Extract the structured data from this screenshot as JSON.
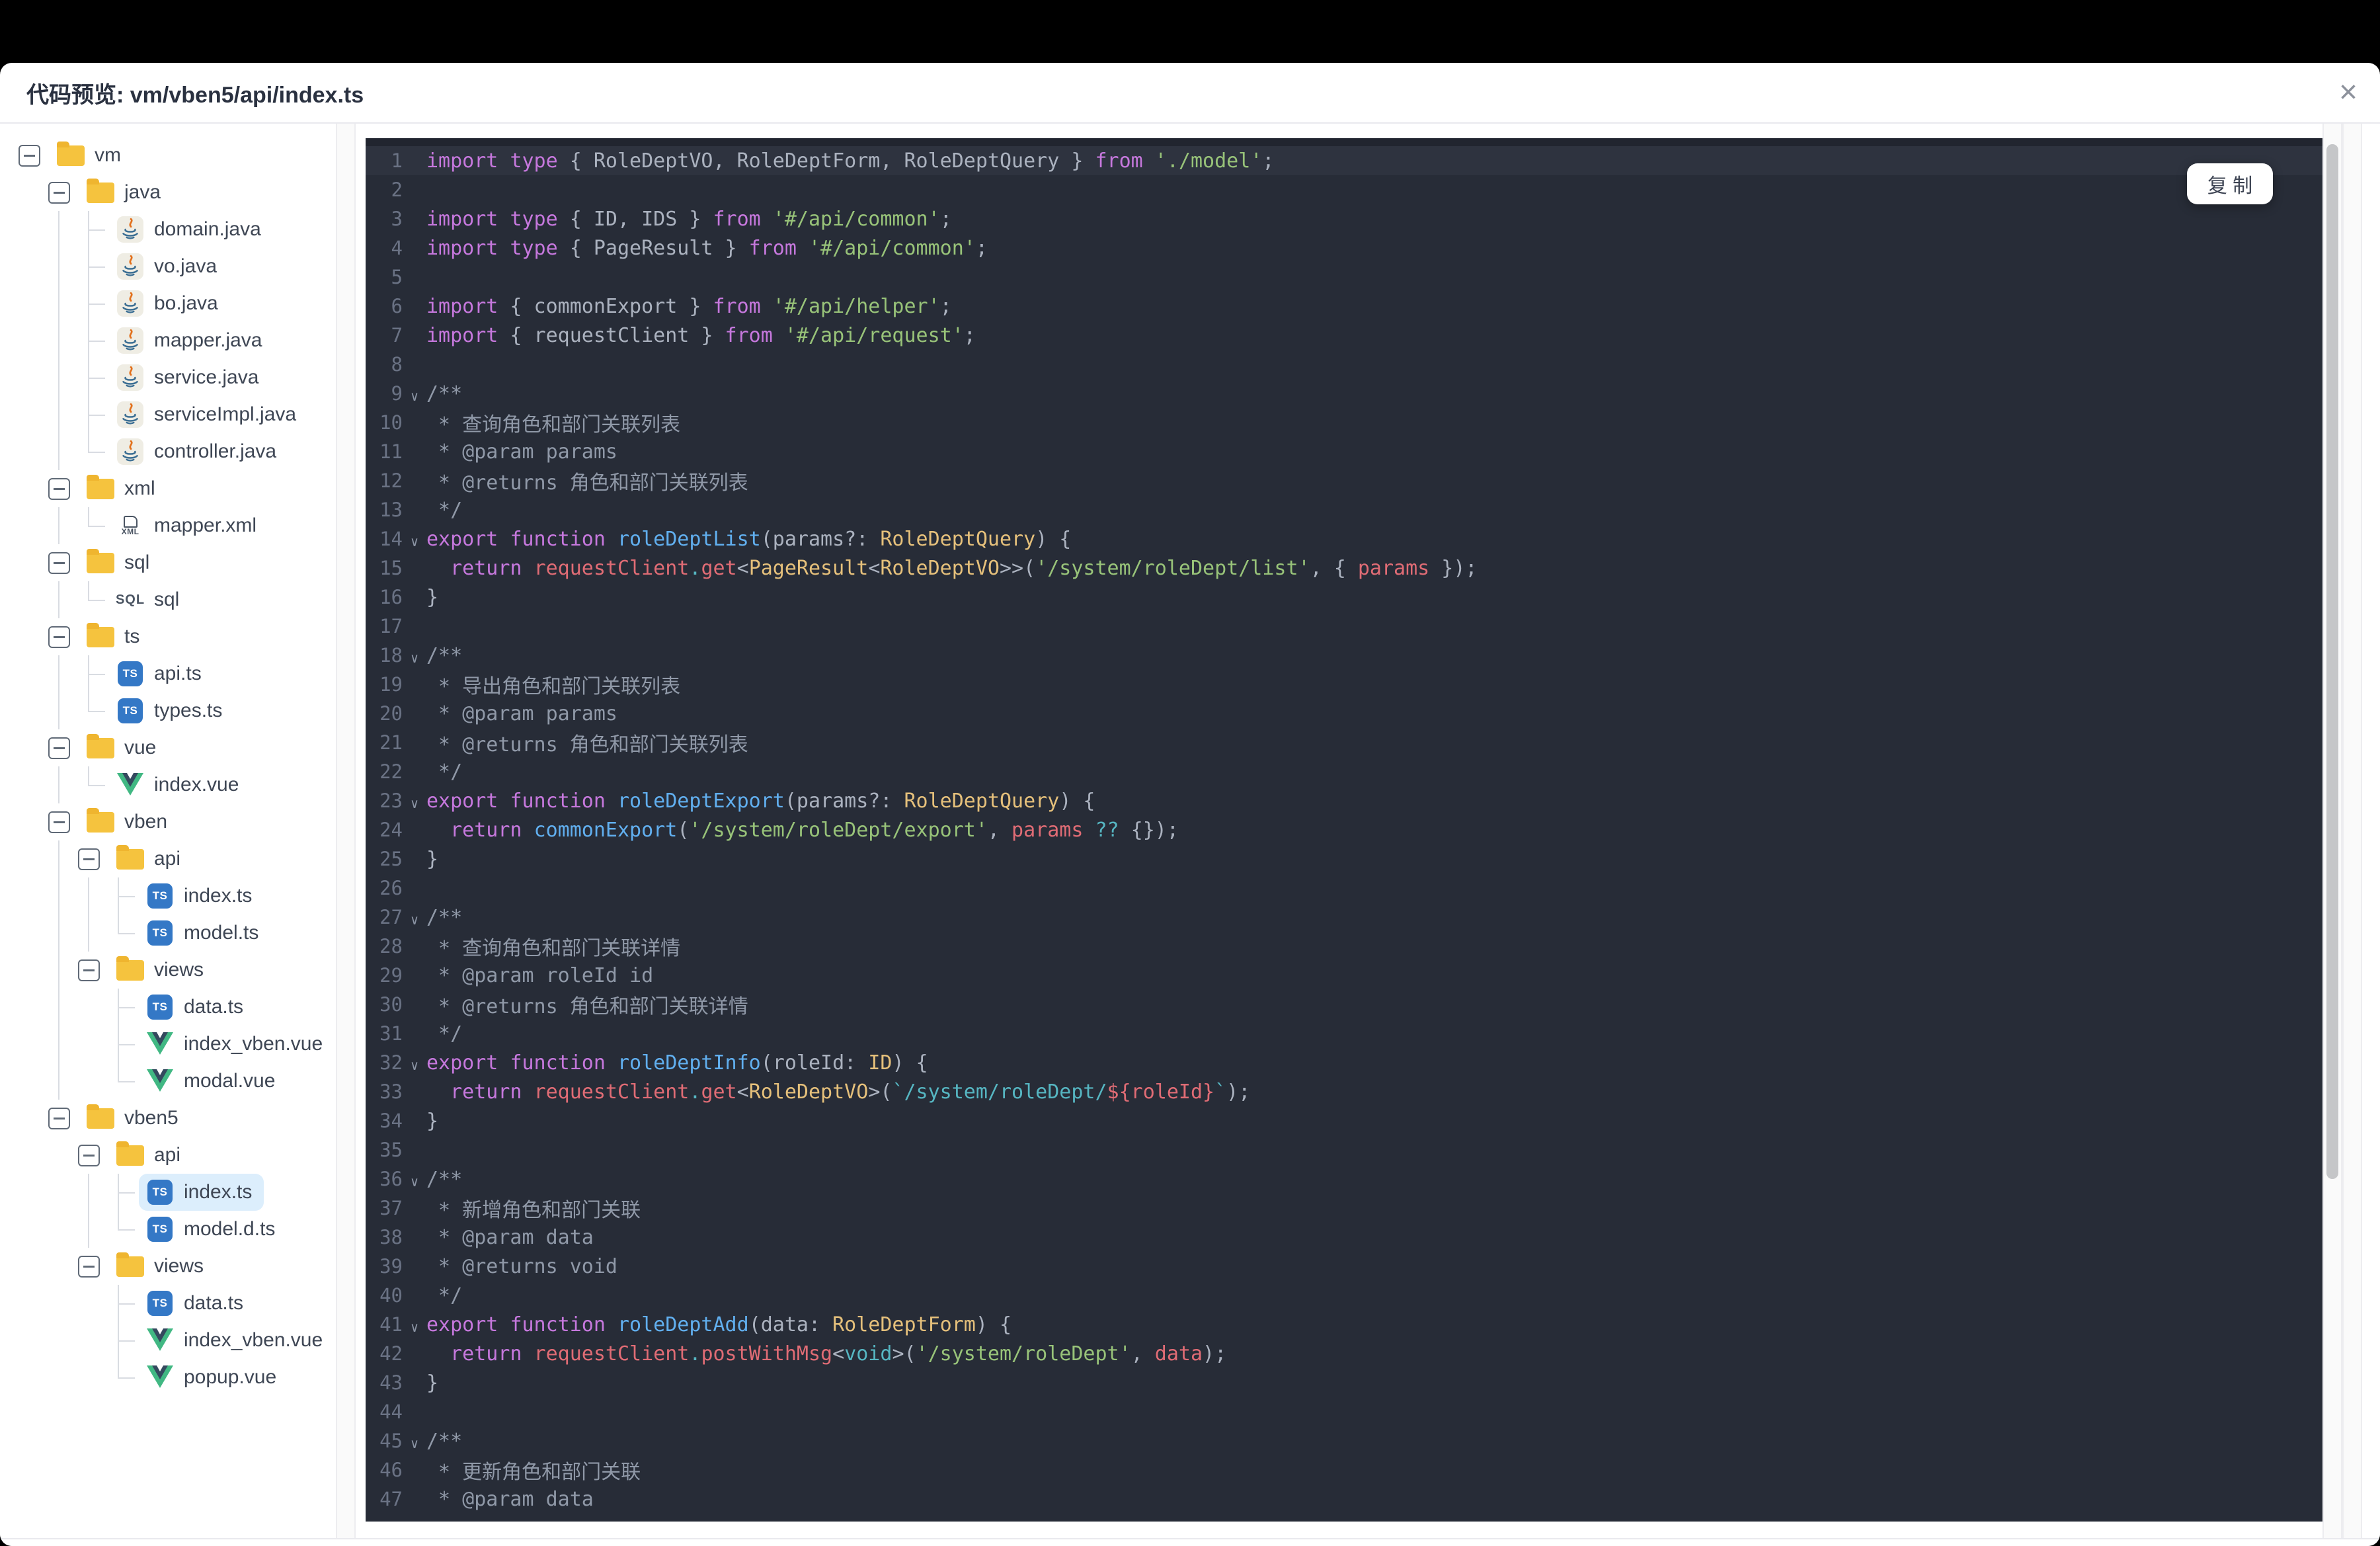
{
  "window": {
    "title": "代码预览: vm/vben5/api/index.ts",
    "close_glyph": "×"
  },
  "copy_button": {
    "label": "复 制"
  },
  "tree": {
    "icon_labels": {
      "ts": "TS",
      "xml": "XML",
      "sql": "SQL"
    },
    "items": [
      {
        "label": "vm",
        "type": "folder",
        "icon": "folder",
        "depth": 0
      },
      {
        "label": "java",
        "type": "folder",
        "icon": "folder",
        "depth": 1
      },
      {
        "label": "domain.java",
        "type": "file",
        "icon": "java",
        "depth": 2,
        "guides": [
          1
        ]
      },
      {
        "label": "vo.java",
        "type": "file",
        "icon": "java",
        "depth": 2,
        "guides": [
          1
        ]
      },
      {
        "label": "bo.java",
        "type": "file",
        "icon": "java",
        "depth": 2,
        "guides": [
          1
        ]
      },
      {
        "label": "mapper.java",
        "type": "file",
        "icon": "java",
        "depth": 2,
        "guides": [
          1
        ]
      },
      {
        "label": "service.java",
        "type": "file",
        "icon": "java",
        "depth": 2,
        "guides": [
          1
        ]
      },
      {
        "label": "serviceImpl.java",
        "type": "file",
        "icon": "java",
        "depth": 2,
        "guides": [
          1
        ]
      },
      {
        "label": "controller.java",
        "type": "file",
        "icon": "java",
        "depth": 2,
        "guides": [
          1
        ],
        "last": true
      },
      {
        "label": "xml",
        "type": "folder",
        "icon": "folder",
        "depth": 1
      },
      {
        "label": "mapper.xml",
        "type": "file",
        "icon": "xml",
        "depth": 2,
        "guides": [
          1
        ],
        "last": true
      },
      {
        "label": "sql",
        "type": "folder",
        "icon": "folder",
        "depth": 1
      },
      {
        "label": "sql",
        "type": "file",
        "icon": "sql",
        "depth": 2,
        "guides": [
          1
        ],
        "last": true
      },
      {
        "label": "ts",
        "type": "folder",
        "icon": "folder",
        "depth": 1
      },
      {
        "label": "api.ts",
        "type": "file",
        "icon": "ts",
        "depth": 2,
        "guides": [
          1
        ]
      },
      {
        "label": "types.ts",
        "type": "file",
        "icon": "ts",
        "depth": 2,
        "guides": [
          1
        ],
        "last": true
      },
      {
        "label": "vue",
        "type": "folder",
        "icon": "folder",
        "depth": 1
      },
      {
        "label": "index.vue",
        "type": "file",
        "icon": "vue",
        "depth": 2,
        "guides": [
          1
        ],
        "last": true
      },
      {
        "label": "vben",
        "type": "folder",
        "icon": "folder",
        "depth": 1
      },
      {
        "label": "api",
        "type": "folder",
        "icon": "folder",
        "depth": 2,
        "guides": [
          1
        ]
      },
      {
        "label": "index.ts",
        "type": "file",
        "icon": "ts",
        "depth": 3,
        "guides": [
          1,
          2
        ]
      },
      {
        "label": "model.ts",
        "type": "file",
        "icon": "ts",
        "depth": 3,
        "guides": [
          1,
          2
        ],
        "last": true
      },
      {
        "label": "views",
        "type": "folder",
        "icon": "folder",
        "depth": 2,
        "guides": [
          1
        ]
      },
      {
        "label": "data.ts",
        "type": "file",
        "icon": "ts",
        "depth": 3,
        "guides": [
          1
        ]
      },
      {
        "label": "index_vben.vue",
        "type": "file",
        "icon": "vue",
        "depth": 3,
        "guides": [
          1
        ]
      },
      {
        "label": "modal.vue",
        "type": "file",
        "icon": "vue",
        "depth": 3,
        "guides": [
          1
        ],
        "last": true
      },
      {
        "label": "vben5",
        "type": "folder",
        "icon": "folder",
        "depth": 1
      },
      {
        "label": "api",
        "type": "folder",
        "icon": "folder",
        "depth": 2
      },
      {
        "label": "index.ts",
        "type": "file",
        "icon": "ts",
        "depth": 3,
        "guides": [
          2
        ],
        "selected": true
      },
      {
        "label": "model.d.ts",
        "type": "file",
        "icon": "ts",
        "depth": 3,
        "guides": [
          2
        ],
        "last": true
      },
      {
        "label": "views",
        "type": "folder",
        "icon": "folder",
        "depth": 2
      },
      {
        "label": "data.ts",
        "type": "file",
        "icon": "ts",
        "depth": 3
      },
      {
        "label": "index_vben.vue",
        "type": "file",
        "icon": "vue",
        "depth": 3
      },
      {
        "label": "popup.vue",
        "type": "file",
        "icon": "vue",
        "depth": 3,
        "last": true
      }
    ]
  },
  "code": {
    "fold_glyph": "∨",
    "lines": [
      {
        "n": 1,
        "hl": true,
        "t": [
          [
            "kw",
            "import"
          ],
          [
            "d",
            " "
          ],
          [
            "kw",
            "type"
          ],
          [
            "d",
            " { RoleDeptVO, RoleDeptForm, RoleDeptQuery } "
          ],
          [
            "kw",
            "from"
          ],
          [
            "d",
            " "
          ],
          [
            "str",
            "'./model'"
          ],
          [
            "d",
            ";"
          ]
        ]
      },
      {
        "n": 2,
        "t": []
      },
      {
        "n": 3,
        "t": [
          [
            "kw",
            "import"
          ],
          [
            "d",
            " "
          ],
          [
            "kw",
            "type"
          ],
          [
            "d",
            " { ID, IDS } "
          ],
          [
            "kw",
            "from"
          ],
          [
            "d",
            " "
          ],
          [
            "str",
            "'#/api/common'"
          ],
          [
            "d",
            ";"
          ]
        ]
      },
      {
        "n": 4,
        "t": [
          [
            "kw",
            "import"
          ],
          [
            "d",
            " "
          ],
          [
            "kw",
            "type"
          ],
          [
            "d",
            " { PageResult } "
          ],
          [
            "kw",
            "from"
          ],
          [
            "d",
            " "
          ],
          [
            "str",
            "'#/api/common'"
          ],
          [
            "d",
            ";"
          ]
        ]
      },
      {
        "n": 5,
        "t": []
      },
      {
        "n": 6,
        "t": [
          [
            "kw",
            "import"
          ],
          [
            "d",
            " { commonExport } "
          ],
          [
            "kw",
            "from"
          ],
          [
            "d",
            " "
          ],
          [
            "str",
            "'#/api/helper'"
          ],
          [
            "d",
            ";"
          ]
        ]
      },
      {
        "n": 7,
        "t": [
          [
            "kw",
            "import"
          ],
          [
            "d",
            " { requestClient } "
          ],
          [
            "kw",
            "from"
          ],
          [
            "d",
            " "
          ],
          [
            "str",
            "'#/api/request'"
          ],
          [
            "d",
            ";"
          ]
        ]
      },
      {
        "n": 8,
        "t": []
      },
      {
        "n": 9,
        "fold": true,
        "t": [
          [
            "cmt",
            "/**"
          ]
        ]
      },
      {
        "n": 10,
        "t": [
          [
            "cmt",
            " * 查询角色和部门关联列表"
          ]
        ]
      },
      {
        "n": 11,
        "t": [
          [
            "cmt",
            " * @param params"
          ]
        ]
      },
      {
        "n": 12,
        "t": [
          [
            "cmt",
            " * @returns 角色和部门关联列表"
          ]
        ]
      },
      {
        "n": 13,
        "t": [
          [
            "cmt",
            " */"
          ]
        ]
      },
      {
        "n": 14,
        "fold": true,
        "t": [
          [
            "kw",
            "export"
          ],
          [
            "d",
            " "
          ],
          [
            "kw",
            "function"
          ],
          [
            "d",
            " "
          ],
          [
            "fn",
            "roleDeptList"
          ],
          [
            "d",
            "(params?: "
          ],
          [
            "ty",
            "RoleDeptQuery"
          ],
          [
            "d",
            ") {"
          ]
        ]
      },
      {
        "n": 15,
        "t": [
          [
            "d",
            "  "
          ],
          [
            "kw",
            "return"
          ],
          [
            "d",
            " "
          ],
          [
            "v",
            "requestClient"
          ],
          [
            "cy",
            "."
          ],
          [
            "v",
            "get"
          ],
          [
            "d",
            "<"
          ],
          [
            "ty",
            "PageResult"
          ],
          [
            "d",
            "<"
          ],
          [
            "ty",
            "RoleDeptVO"
          ],
          [
            "d",
            ">>("
          ],
          [
            "str",
            "'/system/roleDept/list'"
          ],
          [
            "d",
            ", { "
          ],
          [
            "v",
            "params"
          ],
          [
            "d",
            " });"
          ]
        ]
      },
      {
        "n": 16,
        "t": [
          [
            "d",
            "}"
          ]
        ]
      },
      {
        "n": 17,
        "t": []
      },
      {
        "n": 18,
        "fold": true,
        "t": [
          [
            "cmt",
            "/**"
          ]
        ]
      },
      {
        "n": 19,
        "t": [
          [
            "cmt",
            " * 导出角色和部门关联列表"
          ]
        ]
      },
      {
        "n": 20,
        "t": [
          [
            "cmt",
            " * @param params"
          ]
        ]
      },
      {
        "n": 21,
        "t": [
          [
            "cmt",
            " * @returns 角色和部门关联列表"
          ]
        ]
      },
      {
        "n": 22,
        "t": [
          [
            "cmt",
            " */"
          ]
        ]
      },
      {
        "n": 23,
        "fold": true,
        "t": [
          [
            "kw",
            "export"
          ],
          [
            "d",
            " "
          ],
          [
            "kw",
            "function"
          ],
          [
            "d",
            " "
          ],
          [
            "fn",
            "roleDeptExport"
          ],
          [
            "d",
            "(params?: "
          ],
          [
            "ty",
            "RoleDeptQuery"
          ],
          [
            "d",
            ") {"
          ]
        ]
      },
      {
        "n": 24,
        "t": [
          [
            "d",
            "  "
          ],
          [
            "kw",
            "return"
          ],
          [
            "d",
            " "
          ],
          [
            "fn",
            "commonExport"
          ],
          [
            "d",
            "("
          ],
          [
            "str",
            "'/system/roleDept/export'"
          ],
          [
            "d",
            ", "
          ],
          [
            "v",
            "params"
          ],
          [
            "d",
            " "
          ],
          [
            "cy",
            "??"
          ],
          [
            "d",
            " {});"
          ]
        ]
      },
      {
        "n": 25,
        "t": [
          [
            "d",
            "}"
          ]
        ]
      },
      {
        "n": 26,
        "t": []
      },
      {
        "n": 27,
        "fold": true,
        "t": [
          [
            "cmt",
            "/**"
          ]
        ]
      },
      {
        "n": 28,
        "t": [
          [
            "cmt",
            " * 查询角色和部门关联详情"
          ]
        ]
      },
      {
        "n": 29,
        "t": [
          [
            "cmt",
            " * @param roleId id"
          ]
        ]
      },
      {
        "n": 30,
        "t": [
          [
            "cmt",
            " * @returns 角色和部门关联详情"
          ]
        ]
      },
      {
        "n": 31,
        "t": [
          [
            "cmt",
            " */"
          ]
        ]
      },
      {
        "n": 32,
        "fold": true,
        "t": [
          [
            "kw",
            "export"
          ],
          [
            "d",
            " "
          ],
          [
            "kw",
            "function"
          ],
          [
            "d",
            " "
          ],
          [
            "fn",
            "roleDeptInfo"
          ],
          [
            "d",
            "(roleId: "
          ],
          [
            "ty",
            "ID"
          ],
          [
            "d",
            ") {"
          ]
        ]
      },
      {
        "n": 33,
        "t": [
          [
            "d",
            "  "
          ],
          [
            "kw",
            "return"
          ],
          [
            "d",
            " "
          ],
          [
            "v",
            "requestClient"
          ],
          [
            "cy",
            "."
          ],
          [
            "v",
            "get"
          ],
          [
            "d",
            "<"
          ],
          [
            "ty",
            "RoleDeptVO"
          ],
          [
            "d",
            ">("
          ],
          [
            "tpl",
            "`/system/roleDept/"
          ],
          [
            "v",
            "${roleId}"
          ],
          [
            "tpl",
            "`"
          ],
          [
            "d",
            ");"
          ]
        ]
      },
      {
        "n": 34,
        "t": [
          [
            "d",
            "}"
          ]
        ]
      },
      {
        "n": 35,
        "t": []
      },
      {
        "n": 36,
        "fold": true,
        "t": [
          [
            "cmt",
            "/**"
          ]
        ]
      },
      {
        "n": 37,
        "t": [
          [
            "cmt",
            " * 新增角色和部门关联"
          ]
        ]
      },
      {
        "n": 38,
        "t": [
          [
            "cmt",
            " * @param data"
          ]
        ]
      },
      {
        "n": 39,
        "t": [
          [
            "cmt",
            " * @returns void"
          ]
        ]
      },
      {
        "n": 40,
        "t": [
          [
            "cmt",
            " */"
          ]
        ]
      },
      {
        "n": 41,
        "fold": true,
        "t": [
          [
            "kw",
            "export"
          ],
          [
            "d",
            " "
          ],
          [
            "kw",
            "function"
          ],
          [
            "d",
            " "
          ],
          [
            "fn",
            "roleDeptAdd"
          ],
          [
            "d",
            "(data: "
          ],
          [
            "ty",
            "RoleDeptForm"
          ],
          [
            "d",
            ") {"
          ]
        ]
      },
      {
        "n": 42,
        "t": [
          [
            "d",
            "  "
          ],
          [
            "kw",
            "return"
          ],
          [
            "d",
            " "
          ],
          [
            "v",
            "requestClient"
          ],
          [
            "cy",
            "."
          ],
          [
            "v",
            "postWithMsg"
          ],
          [
            "d",
            "<"
          ],
          [
            "cy",
            "void"
          ],
          [
            "d",
            ">("
          ],
          [
            "str",
            "'/system/roleDept'"
          ],
          [
            "d",
            ", "
          ],
          [
            "v",
            "data"
          ],
          [
            "d",
            ");"
          ]
        ]
      },
      {
        "n": 43,
        "t": [
          [
            "d",
            "}"
          ]
        ]
      },
      {
        "n": 44,
        "t": []
      },
      {
        "n": 45,
        "fold": true,
        "t": [
          [
            "cmt",
            "/**"
          ]
        ]
      },
      {
        "n": 46,
        "t": [
          [
            "cmt",
            " * 更新角色和部门关联"
          ]
        ]
      },
      {
        "n": 47,
        "t": [
          [
            "cmt",
            " * @param data"
          ]
        ]
      }
    ]
  },
  "colors": {
    "modal_bg": "#ffffff",
    "header_border": "#e9e9ee",
    "title": "#2a3140",
    "close": "#8d929c",
    "code_bg": "#272c37",
    "code_top": "#21252f",
    "line_hl": "#2e333f",
    "lineno": "#6a7284",
    "foldc": "#8a93a3",
    "kw": "#c678dd",
    "d": "#abb2bf",
    "str": "#98c379",
    "fn": "#61afef",
    "ty": "#e5c07b",
    "v": "#e06c75",
    "cy": "#56b6c2",
    "cmt": "#9099a8",
    "tpl": "#56b6c2",
    "tree_text": "#3f4755",
    "guide": "#d9dce2",
    "expander": "#606a77",
    "folder": "#f5c33e",
    "folder_dark": "#efb52f",
    "ts_bg": "#3478c6",
    "vue_green": "#41b883",
    "vue_dark": "#34495e",
    "xml_ic": "#4b5563",
    "sel_bg": "#dceefc",
    "scroll_track": "#fafafa",
    "scroll_border": "#ededf0",
    "thumb": "#c5c6c8",
    "btn_text": "#3c4352"
  }
}
